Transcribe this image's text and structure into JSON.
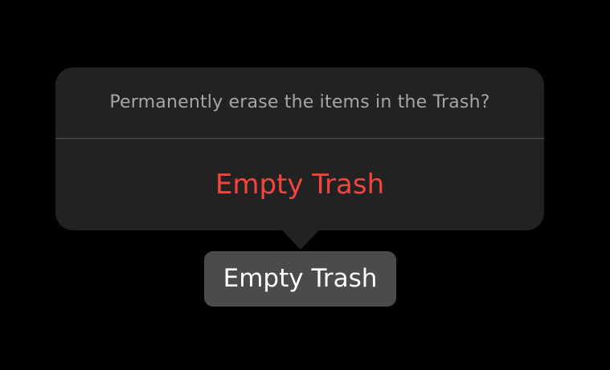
{
  "popover": {
    "message": "Permanently erase the items in the Trash?",
    "action_label": "Empty Trash"
  },
  "trigger": {
    "label": "Empty Trash"
  },
  "colors": {
    "background": "#000000",
    "popover_background": "#222222",
    "message_text": "#a6a6a6",
    "destructive_action": "#f2453d",
    "button_background": "#4b4b4b",
    "button_text": "#ffffff"
  }
}
